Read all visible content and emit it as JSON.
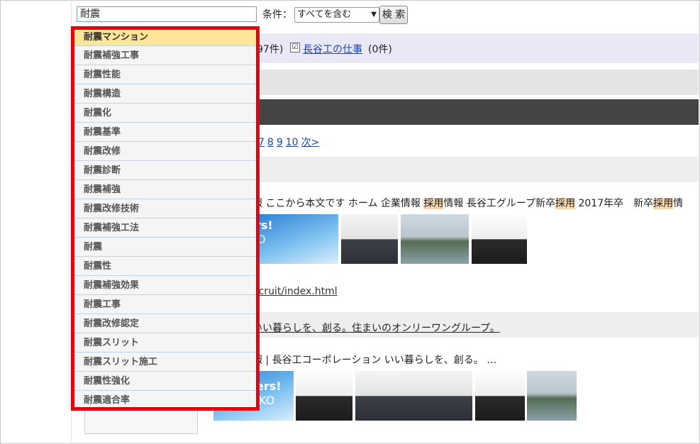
{
  "search": {
    "value": "耐震",
    "condition_label": "条件：",
    "condition_value": "すべてを含む",
    "button_label": "検 索"
  },
  "suggestions": [
    "耐震マンション",
    "耐震補強工事",
    "耐震性能",
    "耐震構造",
    "耐震化",
    "耐震基準",
    "耐震改修",
    "耐震診断",
    "耐震補強",
    "耐震改修技術",
    "耐震補強工法",
    "耐震",
    "耐震性",
    "耐震補強効果",
    "耐震工事",
    "耐震改修認定",
    "耐震スリット",
    "耐震スリット施工",
    "耐震性強化",
    "耐震適合率"
  ],
  "filter": {
    "count1": "97件)",
    "checkbox_mark": "☑",
    "link": "長谷工の仕事",
    "count2": "(0件)"
  },
  "pager": {
    "pages": [
      "7",
      "8",
      "9",
      "10"
    ],
    "next": "次>"
  },
  "result1": {
    "s1": "報 ここから本文です ホーム 企業情報 ",
    "h1": "採用",
    "s2": "情報 長谷工グループ新卒",
    "h2": "採用",
    "s3": " 2017年卒　新卒",
    "h3": "採用",
    "s4": "情",
    "url": "ecruit/index.html",
    "img_text": "rs!",
    "img_text2": "O"
  },
  "result2": {
    "title": "いい暮らしを、創る。住まいのオンリーワングループ。",
    "snippet": "報 | 長谷工コーポレーション いい暮らしを、創る。 …",
    "img_text": "ers!",
    "img_text2": "KO"
  },
  "icons": {
    "dropdown_arrow": "▼"
  }
}
